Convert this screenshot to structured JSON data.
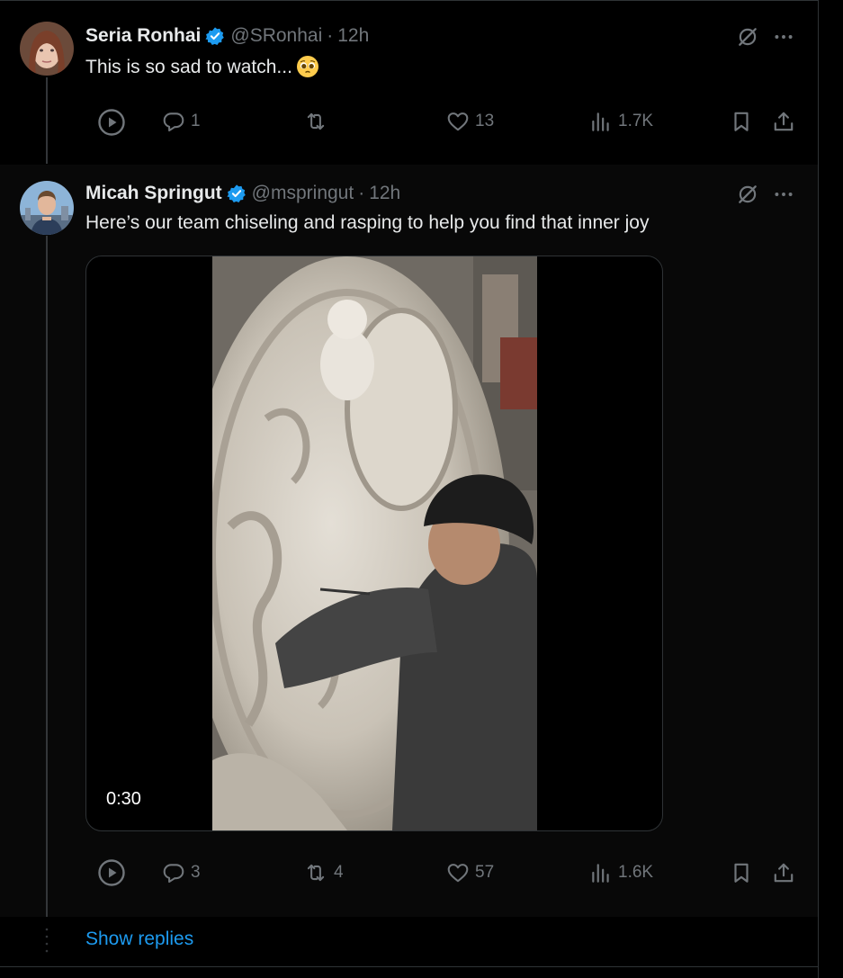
{
  "tweets": [
    {
      "display_name": "Seria Ronhai",
      "handle": "@SRonhai",
      "separator": "·",
      "time": "12h",
      "text": "This is so sad to watch...",
      "emoji": "pleading-face",
      "actions": {
        "reply_count": "1",
        "retweet_count": "",
        "like_count": "13",
        "views": "1.7K"
      }
    },
    {
      "display_name": "Micah Springut",
      "handle": "@mspringut",
      "separator": "·",
      "time": "12h",
      "text": "Here’s our team chiseling and rasping to help you find that inner joy",
      "video": {
        "duration": "0:30"
      },
      "actions": {
        "reply_count": "3",
        "retweet_count": "4",
        "like_count": "57",
        "views": "1.6K"
      }
    }
  ],
  "show_replies_label": "Show replies",
  "colors": {
    "accent": "#1d9bf0",
    "muted": "#71767b",
    "text": "#e7e9ea",
    "background": "#000000"
  }
}
